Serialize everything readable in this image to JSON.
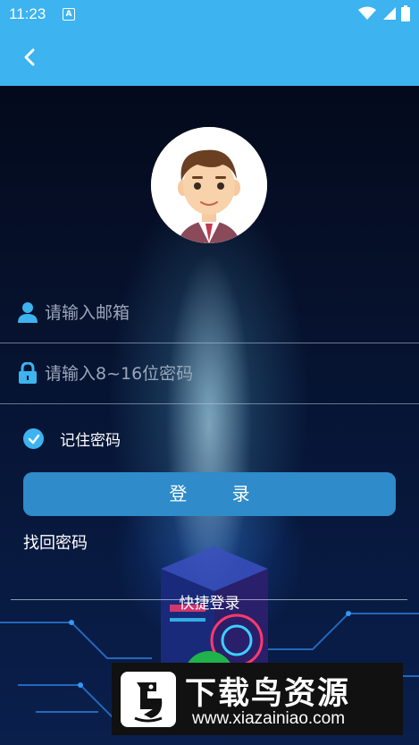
{
  "status_bar": {
    "time": "11:23",
    "notification_icon": "A"
  },
  "app_bar": {
    "back_icon": "chevron-left-icon"
  },
  "avatar": {
    "icon": "cartoon-boy-avatar"
  },
  "form": {
    "email_placeholder": "请输入邮箱",
    "password_placeholder": "请输入8~16位密码",
    "remember_label": "记住密码",
    "remember_checked": true,
    "login_label": "登 录",
    "forgot_label": "找回密码",
    "quick_login_label": "快捷登录"
  },
  "watermark": {
    "title": "下载鸟资源",
    "url": "www.xiazainiao.com"
  },
  "colors": {
    "accent": "#3db3f0",
    "button": "#2f8bc9",
    "background": "#061028"
  }
}
